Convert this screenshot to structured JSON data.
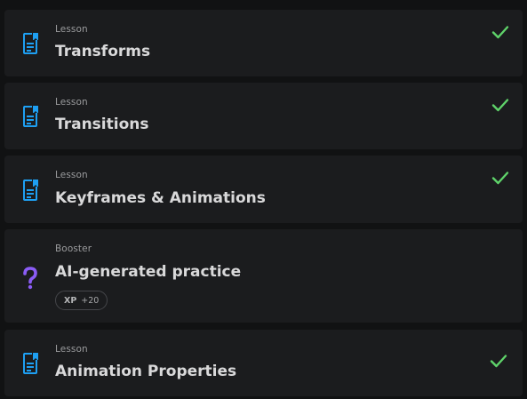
{
  "items": [
    {
      "kind": "Lesson",
      "title": "Transforms",
      "icon": "lesson-document-icon",
      "completed": true
    },
    {
      "kind": "Lesson",
      "title": "Transitions",
      "icon": "lesson-document-icon",
      "completed": true
    },
    {
      "kind": "Lesson",
      "title": "Keyframes & Animations",
      "icon": "lesson-document-icon",
      "completed": true
    },
    {
      "kind": "Booster",
      "title": "AI-generated practice",
      "icon": "question-mark-icon",
      "xp_label": "XP",
      "xp_value": "+20"
    },
    {
      "kind": "Lesson",
      "title": "Animation Properties",
      "icon": "lesson-document-icon",
      "completed": true
    }
  ],
  "colors": {
    "lesson_icon": "#1e9ff2",
    "booster_icon": "#8b5cf6",
    "check": "#5fd36a",
    "card_bg": "#1b1c1e",
    "page_bg": "#111213"
  }
}
